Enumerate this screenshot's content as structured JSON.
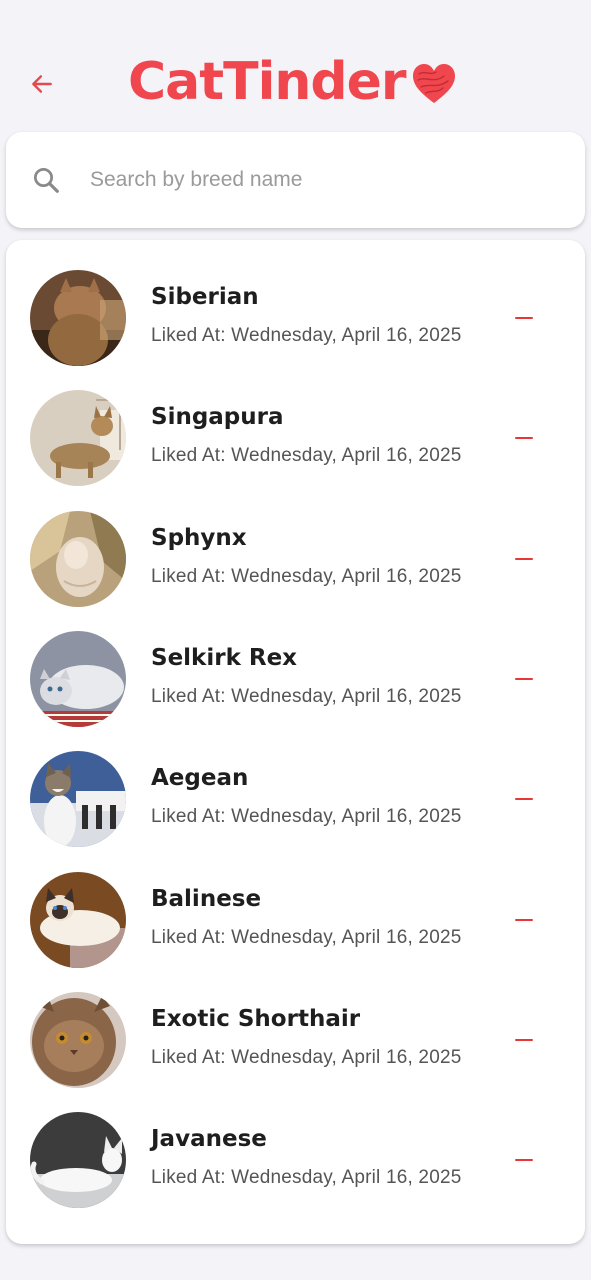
{
  "header": {
    "title": "CatTinder",
    "brand_color": "#f0474f",
    "back_icon": "arrow-left-icon",
    "heart_icon": "heart-icon"
  },
  "search": {
    "placeholder": "Search by breed name",
    "value": "",
    "icon": "search-icon"
  },
  "liked_list": {
    "remove_icon": "minus-icon",
    "accent_color": "#e53935",
    "items": [
      {
        "name": "Siberian",
        "liked_at": "Liked At: Wednesday, April 16, 2025"
      },
      {
        "name": "Singapura",
        "liked_at": "Liked At: Wednesday, April 16, 2025"
      },
      {
        "name": "Sphynx",
        "liked_at": "Liked At: Wednesday, April 16, 2025"
      },
      {
        "name": "Selkirk Rex",
        "liked_at": "Liked At: Wednesday, April 16, 2025"
      },
      {
        "name": "Aegean",
        "liked_at": "Liked At: Wednesday, April 16, 2025"
      },
      {
        "name": "Balinese",
        "liked_at": "Liked At: Wednesday, April 16, 2025"
      },
      {
        "name": "Exotic Shorthair",
        "liked_at": "Liked At: Wednesday, April 16, 2025"
      },
      {
        "name": "Javanese",
        "liked_at": "Liked At: Wednesday, April 16, 2025"
      }
    ]
  }
}
